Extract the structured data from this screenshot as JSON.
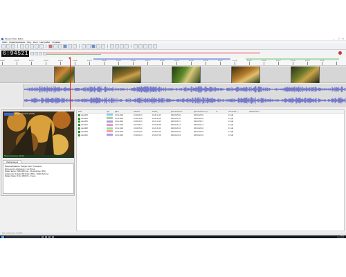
{
  "window": {
    "title": "Movavi Video Editor"
  },
  "menu": [
    "Файл",
    "Редактирование",
    "Вид",
    "Клип",
    "Настройки",
    "Справка"
  ],
  "timecode": "6:94521",
  "ruler_labels": [
    "0:00:06",
    "0:00:12",
    "0:00:18",
    "0:00:24",
    "0:00:30",
    "0:00:36",
    "0:00:42",
    "0:00:48",
    "0:01:00",
    "0:01:06",
    "0:01:12",
    "0:01:18",
    "0:01:24",
    "0:01:30",
    "0:01:36",
    "0:01:42",
    "0:01:48",
    "0:02:00",
    "0:02:06",
    "0:02:12",
    "0:02:18",
    "0:02:24",
    "0:02:30"
  ],
  "preview": {
    "overlay_text": "Видео включено (14:52)",
    "caption": "Видео включено (14:52)"
  },
  "info": {
    "tab_label": "Информация",
    "lines": [
      "Видеоизображение \"Autogen.Camc\" (ссылка на)",
      "Длительность фрагмента: 1 час 00 мин",
      "Размер видео: 1920x1080 пикс., 25 кадров/сек. (PAL)",
      "Компрессия: SoftLab-NSK Motion JPEG ; 12000 кбайт/сек",
      "Формат Звука: 16 бит, 48000 Гц, Стерео"
    ]
  },
  "table": {
    "headers": [
      "Имя",
      "Цв...",
      "Дата",
      "Начало",
      "Конец",
      "Длительность",
      "Длительность (в...",
      "Л...",
      "Усиление (...",
      "Изменение г..."
    ],
    "rows": [
      {
        "name": "ubie0003",
        "date": "13.01.2020",
        "start": "16:19:46,13",
        "end": "16:20:11,15",
        "dur": "000:00:25,02",
        "dur2": "000:00:25,02",
        "gain": "0,0 дБ",
        "color": "#9ec3f0"
      },
      {
        "name": "ubie0004",
        "date": "13.01.2020",
        "start": "16:20:16,06",
        "end": "16:20:33,05",
        "dur": "000:00:16,24",
        "dur2": "000:00:16,24",
        "gain": "0,0 дБ",
        "color": "#9dd89a"
      },
      {
        "name": "ubie0005",
        "date": "13.01.2020",
        "start": "16:20:34,23",
        "end": "16:21:11,10",
        "dur": "000:00:36,17",
        "dur2": "000:00:36,17",
        "gain": "0,0 дБ",
        "color": "#b49be0"
      },
      {
        "name": "ubie0007",
        "date": "13.01.2020",
        "start": "16:21:35,17",
        "end": "16:21:55,05",
        "dur": "000:00:21,13",
        "dur2": "000:00:21,13",
        "gain": "0,0 дБ",
        "color": "#e59ad0"
      },
      {
        "name": "ubie0008",
        "date": "13.01.2020",
        "start": "16:22:05,19",
        "end": "16:22:32,10",
        "dur": "000:00:26,16",
        "dur2": "000:00:26,16",
        "gain": "0,0 дБ",
        "color": "#9dd89a"
      },
      {
        "name": "ubie0009",
        "date": "13.01.2020",
        "start": "16:22:40,07",
        "end": "16:23:01,00",
        "dur": "000:00:20,18",
        "dur2": "000:00:20,18",
        "gain": "0,0 дБ",
        "color": "#f2a99a"
      },
      {
        "name": "ubie0010",
        "date": "13.01.2020",
        "start": "16:16:42,13",
        "end": "16:22:07,09",
        "dur": "000:00:24,19",
        "dur2": "000:00:24,19",
        "gain": "0,0 дБ",
        "color": "#b49be0"
      }
    ]
  },
  "status": "Изм. изображение: ubie0004",
  "tray": {
    "time": "16:21",
    "date": "13.01.2020"
  },
  "colors": {
    "waveform": "#5c62c8",
    "playhead": "#dd2222",
    "timecode_bg": "#111111",
    "progress_pink": "#f2c2c8"
  }
}
